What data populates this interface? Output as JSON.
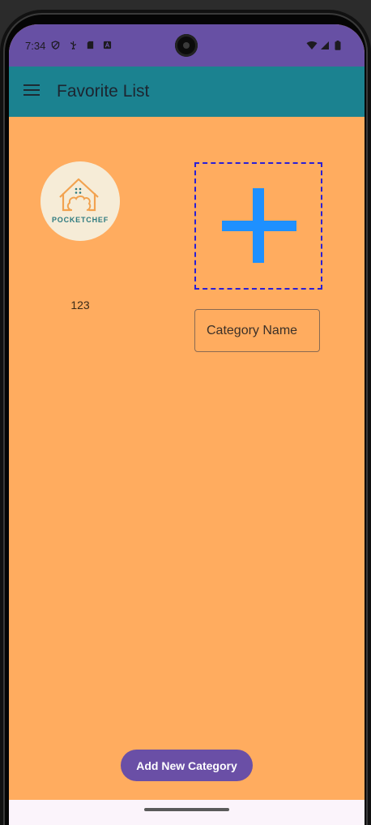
{
  "status_bar": {
    "time": "7:34",
    "left_icons": [
      "shield-icon",
      "usb-icon",
      "sd-card-icon",
      "app-notification-icon"
    ],
    "right_icons": [
      "wifi-icon",
      "signal-icon",
      "battery-icon"
    ],
    "background": "#6750a4"
  },
  "app_bar": {
    "title": "Favorite List",
    "menu_icon": "hamburger-menu-icon",
    "background": "#1b8290"
  },
  "main": {
    "background": "#ffac5f",
    "category_card": {
      "logo_text": "POCKETCHEF",
      "caption": "123"
    },
    "add_image": {
      "icon": "plus-icon",
      "icon_color": "#1e90ff",
      "border_color": "#2a1fd6"
    },
    "category_input": {
      "value": "",
      "placeholder": "Category Name"
    },
    "add_button": {
      "label": "Add New Category",
      "background": "#6a4fa6"
    }
  },
  "navigation_bar": {
    "handle": "gesture-handle"
  }
}
